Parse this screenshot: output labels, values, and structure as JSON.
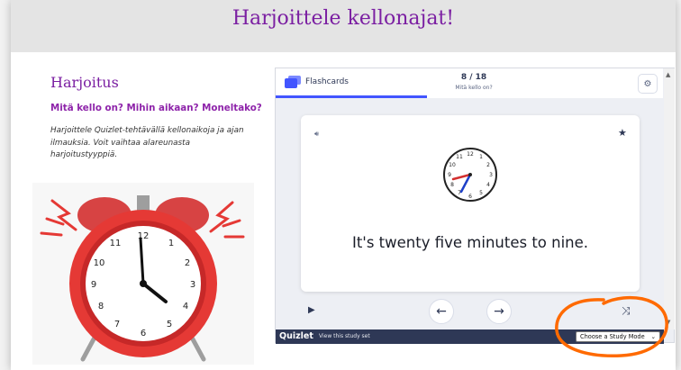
{
  "header": {
    "title": "Harjoittele kellonajat!"
  },
  "left": {
    "section_title": "Harjoitus",
    "subtitle": "Mitä kello on? Mihin aikaan? Moneltako?",
    "description": "Harjoittele Quizlet-tehtävällä kellonaikoja ja ajan ilmauksia. Voit vaihtaa alareunasta harjoitustyyppiä."
  },
  "quizlet": {
    "mode_label": "Flashcards",
    "counter": "8 / 18",
    "counter_sub": "Mitä kello on?",
    "card_text": "It's twenty five minutes to nine.",
    "brand": "Quizlet",
    "view_set": "View this study set",
    "study_mode": "Choose a Study Mode",
    "icons": {
      "mode": "flashcards-icon",
      "settings": "gear-icon",
      "audio": "speaker-icon",
      "star": "star-icon",
      "play": "play-icon",
      "prev": "arrow-left-icon",
      "next": "arrow-right-icon",
      "shuffle": "shuffle-icon",
      "dropdown": "chevron-down-icon"
    }
  },
  "colors": {
    "title_purple": "#7b1fa2",
    "subtitle_purple": "#8e24aa",
    "quizlet_blue": "#4255ff",
    "quizlet_navy": "#2e3856",
    "annotation_orange": "#ff6a00",
    "alarm_red": "#e53935"
  }
}
